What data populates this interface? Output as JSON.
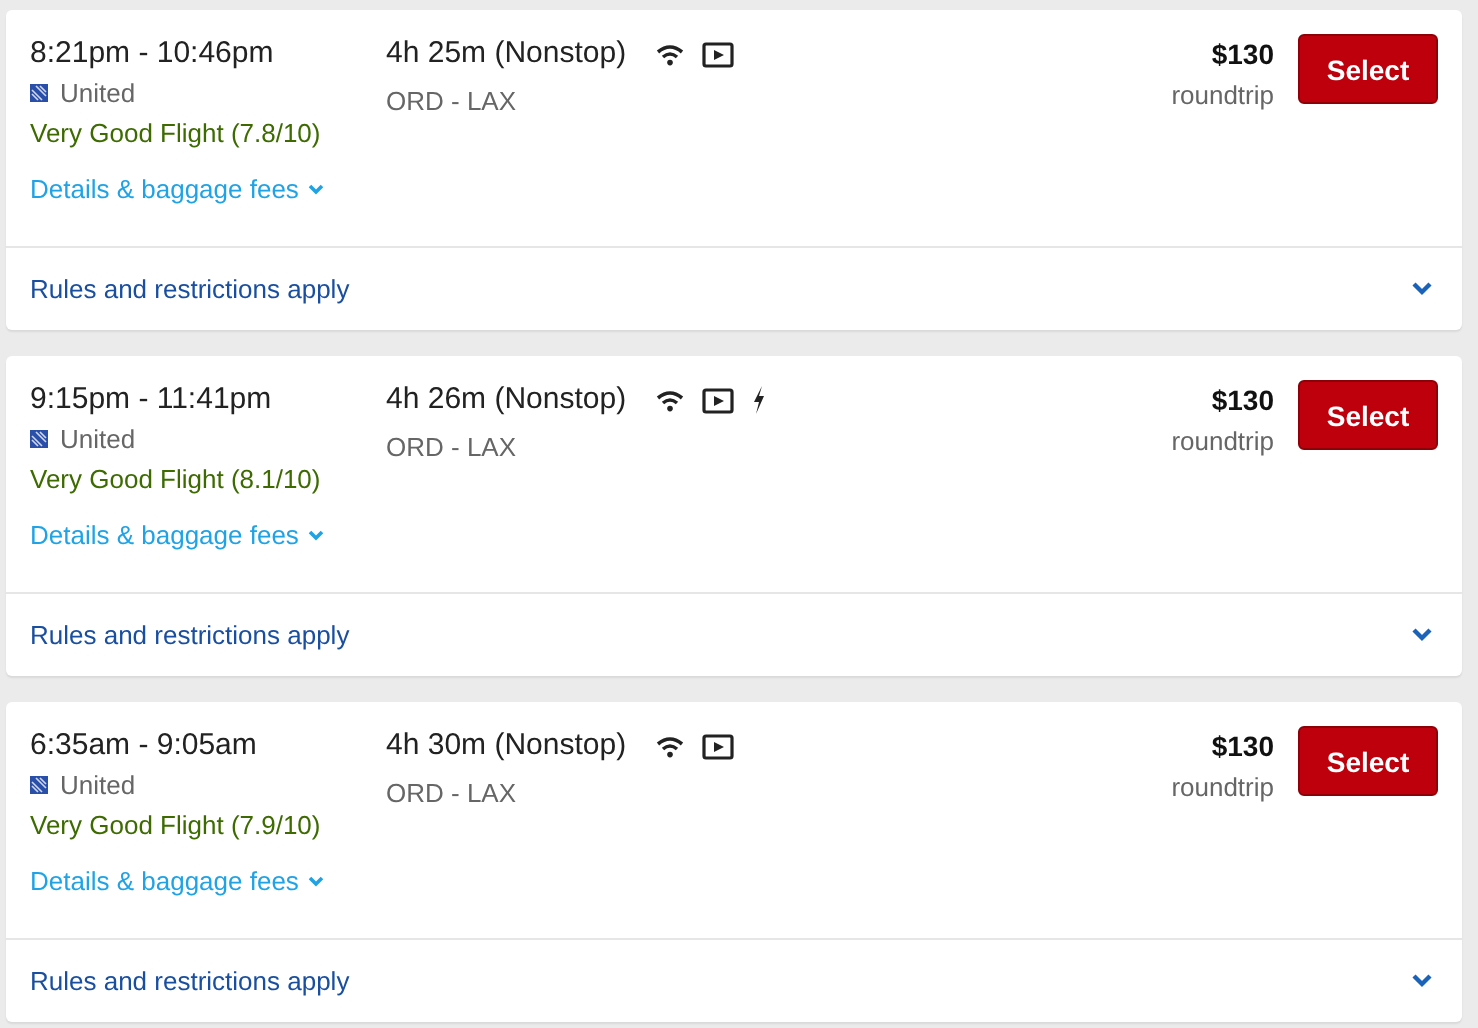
{
  "flights": [
    {
      "times": "8:21pm - 10:46pm",
      "airline": "United",
      "rating": "Very Good Flight (7.8/10)",
      "details_link": "Details & baggage fees",
      "duration": "4h 25m (Nonstop)",
      "amenities": [
        {
          "kind": "wifi"
        },
        {
          "kind": "video"
        }
      ],
      "route": "ORD - LAX",
      "price": "$130",
      "trip_type": "roundtrip",
      "button": "Select",
      "rules_link": "Rules and restrictions apply"
    },
    {
      "times": "9:15pm - 11:41pm",
      "airline": "United",
      "rating": "Very Good Flight (8.1/10)",
      "details_link": "Details & baggage fees",
      "duration": "4h 26m (Nonstop)",
      "amenities": [
        {
          "kind": "wifi"
        },
        {
          "kind": "video"
        },
        {
          "kind": "power"
        }
      ],
      "route": "ORD - LAX",
      "price": "$130",
      "trip_type": "roundtrip",
      "button": "Select",
      "rules_link": "Rules and restrictions apply"
    },
    {
      "times": "6:35am - 9:05am",
      "airline": "United",
      "rating": "Very Good Flight (7.9/10)",
      "details_link": "Details & baggage fees",
      "duration": "4h 30m (Nonstop)",
      "amenities": [
        {
          "kind": "wifi"
        },
        {
          "kind": "video"
        }
      ],
      "route": "ORD - LAX",
      "price": "$130",
      "trip_type": "roundtrip",
      "button": "Select",
      "rules_link": "Rules and restrictions apply"
    }
  ]
}
